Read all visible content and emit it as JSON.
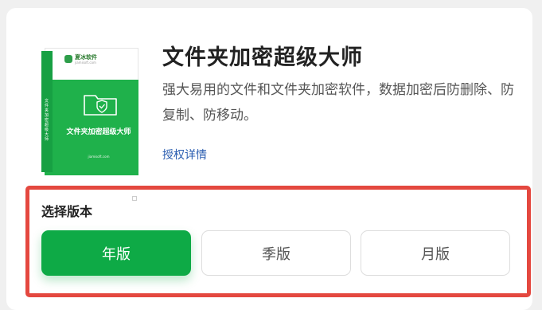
{
  "product": {
    "title": "文件夹加密超级大师",
    "description": "强大易用的文件和文件夹加密软件，数据加密后防删除、防复制、防移动。",
    "license_link": "授权详情",
    "box": {
      "brand": "夏冰软件",
      "brand_sub": "jiamisoft.com",
      "name": "文件夹加密超级大师",
      "side_text": "文件夹加密超级大师",
      "domain": "jiamisoft.com",
      "front_color": "#1fb14b"
    }
  },
  "version_select": {
    "label": "选择版本",
    "options": [
      {
        "label": "年版",
        "selected": true
      },
      {
        "label": "季版",
        "selected": false
      },
      {
        "label": "月版",
        "selected": false
      }
    ],
    "highlight_border_color": "#e4483f",
    "selected_color": "#0eaa46"
  }
}
